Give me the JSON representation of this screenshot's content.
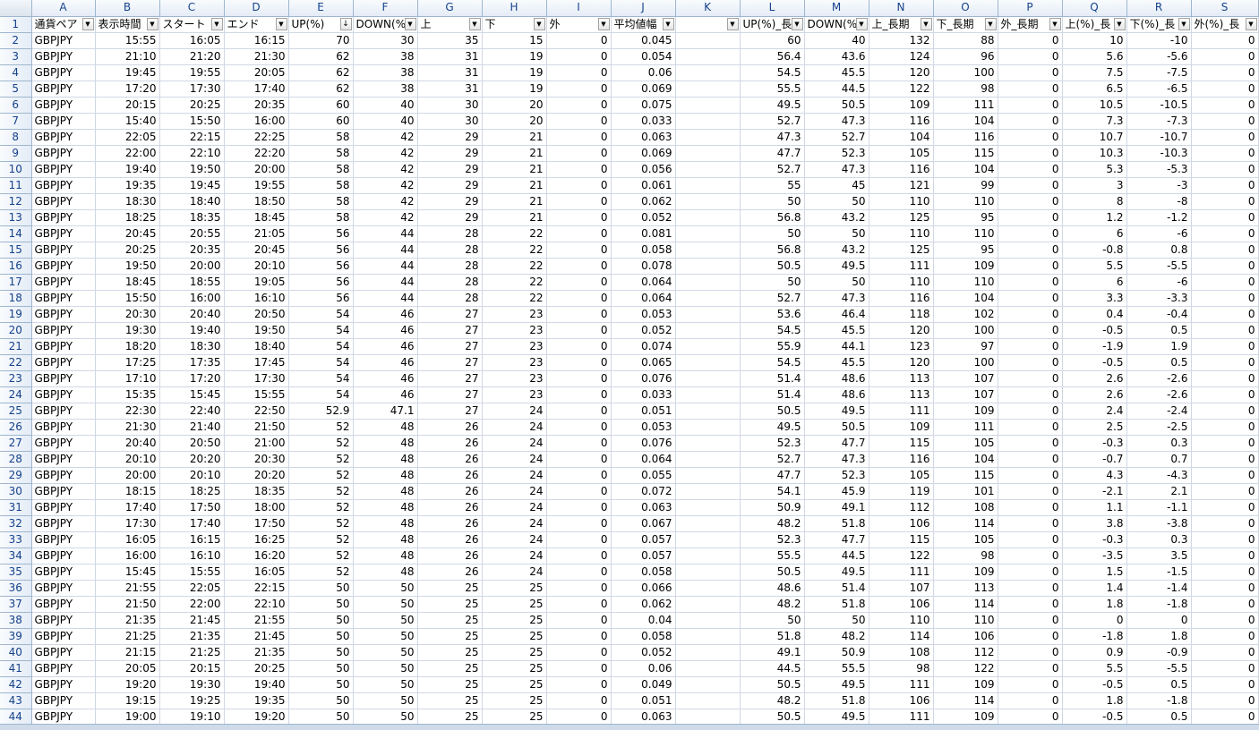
{
  "columns": [
    "A",
    "B",
    "C",
    "D",
    "E",
    "F",
    "G",
    "H",
    "I",
    "J",
    "K",
    "L",
    "M",
    "N",
    "O",
    "P",
    "Q",
    "R",
    "S"
  ],
  "header_row_number": "1",
  "headers": [
    "通貨ペア",
    "表示時間",
    "スタート",
    "エンド",
    "UP(%)",
    "DOWN(%)",
    "上",
    "下",
    "外",
    "平均値幅",
    "",
    "UP(%)_長",
    "DOWN(%)",
    "上_長期",
    "下_長期",
    "外_長期",
    "上(%)_長",
    "下(%)_長",
    "外(%)_長"
  ],
  "sorted_column_index": 4,
  "filter_icon": "▼",
  "sorted_icon": "↓",
  "rows": [
    [
      "2",
      "GBPJPY",
      "15:55",
      "16:05",
      "16:15",
      "70",
      "30",
      "35",
      "15",
      "0",
      "0.045",
      "",
      "60",
      "40",
      "132",
      "88",
      "0",
      "10",
      "-10",
      "0"
    ],
    [
      "3",
      "GBPJPY",
      "21:10",
      "21:20",
      "21:30",
      "62",
      "38",
      "31",
      "19",
      "0",
      "0.054",
      "",
      "56.4",
      "43.6",
      "124",
      "96",
      "0",
      "5.6",
      "-5.6",
      "0"
    ],
    [
      "4",
      "GBPJPY",
      "19:45",
      "19:55",
      "20:05",
      "62",
      "38",
      "31",
      "19",
      "0",
      "0.06",
      "",
      "54.5",
      "45.5",
      "120",
      "100",
      "0",
      "7.5",
      "-7.5",
      "0"
    ],
    [
      "5",
      "GBPJPY",
      "17:20",
      "17:30",
      "17:40",
      "62",
      "38",
      "31",
      "19",
      "0",
      "0.069",
      "",
      "55.5",
      "44.5",
      "122",
      "98",
      "0",
      "6.5",
      "-6.5",
      "0"
    ],
    [
      "6",
      "GBPJPY",
      "20:15",
      "20:25",
      "20:35",
      "60",
      "40",
      "30",
      "20",
      "0",
      "0.075",
      "",
      "49.5",
      "50.5",
      "109",
      "111",
      "0",
      "10.5",
      "-10.5",
      "0"
    ],
    [
      "7",
      "GBPJPY",
      "15:40",
      "15:50",
      "16:00",
      "60",
      "40",
      "30",
      "20",
      "0",
      "0.033",
      "",
      "52.7",
      "47.3",
      "116",
      "104",
      "0",
      "7.3",
      "-7.3",
      "0"
    ],
    [
      "8",
      "GBPJPY",
      "22:05",
      "22:15",
      "22:25",
      "58",
      "42",
      "29",
      "21",
      "0",
      "0.063",
      "",
      "47.3",
      "52.7",
      "104",
      "116",
      "0",
      "10.7",
      "-10.7",
      "0"
    ],
    [
      "9",
      "GBPJPY",
      "22:00",
      "22:10",
      "22:20",
      "58",
      "42",
      "29",
      "21",
      "0",
      "0.069",
      "",
      "47.7",
      "52.3",
      "105",
      "115",
      "0",
      "10.3",
      "-10.3",
      "0"
    ],
    [
      "10",
      "GBPJPY",
      "19:40",
      "19:50",
      "20:00",
      "58",
      "42",
      "29",
      "21",
      "0",
      "0.056",
      "",
      "52.7",
      "47.3",
      "116",
      "104",
      "0",
      "5.3",
      "-5.3",
      "0"
    ],
    [
      "11",
      "GBPJPY",
      "19:35",
      "19:45",
      "19:55",
      "58",
      "42",
      "29",
      "21",
      "0",
      "0.061",
      "",
      "55",
      "45",
      "121",
      "99",
      "0",
      "3",
      "-3",
      "0"
    ],
    [
      "12",
      "GBPJPY",
      "18:30",
      "18:40",
      "18:50",
      "58",
      "42",
      "29",
      "21",
      "0",
      "0.062",
      "",
      "50",
      "50",
      "110",
      "110",
      "0",
      "8",
      "-8",
      "0"
    ],
    [
      "13",
      "GBPJPY",
      "18:25",
      "18:35",
      "18:45",
      "58",
      "42",
      "29",
      "21",
      "0",
      "0.052",
      "",
      "56.8",
      "43.2",
      "125",
      "95",
      "0",
      "1.2",
      "-1.2",
      "0"
    ],
    [
      "14",
      "GBPJPY",
      "20:45",
      "20:55",
      "21:05",
      "56",
      "44",
      "28",
      "22",
      "0",
      "0.081",
      "",
      "50",
      "50",
      "110",
      "110",
      "0",
      "6",
      "-6",
      "0"
    ],
    [
      "15",
      "GBPJPY",
      "20:25",
      "20:35",
      "20:45",
      "56",
      "44",
      "28",
      "22",
      "0",
      "0.058",
      "",
      "56.8",
      "43.2",
      "125",
      "95",
      "0",
      "-0.8",
      "0.8",
      "0"
    ],
    [
      "16",
      "GBPJPY",
      "19:50",
      "20:00",
      "20:10",
      "56",
      "44",
      "28",
      "22",
      "0",
      "0.078",
      "",
      "50.5",
      "49.5",
      "111",
      "109",
      "0",
      "5.5",
      "-5.5",
      "0"
    ],
    [
      "17",
      "GBPJPY",
      "18:45",
      "18:55",
      "19:05",
      "56",
      "44",
      "28",
      "22",
      "0",
      "0.064",
      "",
      "50",
      "50",
      "110",
      "110",
      "0",
      "6",
      "-6",
      "0"
    ],
    [
      "18",
      "GBPJPY",
      "15:50",
      "16:00",
      "16:10",
      "56",
      "44",
      "28",
      "22",
      "0",
      "0.064",
      "",
      "52.7",
      "47.3",
      "116",
      "104",
      "0",
      "3.3",
      "-3.3",
      "0"
    ],
    [
      "19",
      "GBPJPY",
      "20:30",
      "20:40",
      "20:50",
      "54",
      "46",
      "27",
      "23",
      "0",
      "0.053",
      "",
      "53.6",
      "46.4",
      "118",
      "102",
      "0",
      "0.4",
      "-0.4",
      "0"
    ],
    [
      "20",
      "GBPJPY",
      "19:30",
      "19:40",
      "19:50",
      "54",
      "46",
      "27",
      "23",
      "0",
      "0.052",
      "",
      "54.5",
      "45.5",
      "120",
      "100",
      "0",
      "-0.5",
      "0.5",
      "0"
    ],
    [
      "21",
      "GBPJPY",
      "18:20",
      "18:30",
      "18:40",
      "54",
      "46",
      "27",
      "23",
      "0",
      "0.074",
      "",
      "55.9",
      "44.1",
      "123",
      "97",
      "0",
      "-1.9",
      "1.9",
      "0"
    ],
    [
      "22",
      "GBPJPY",
      "17:25",
      "17:35",
      "17:45",
      "54",
      "46",
      "27",
      "23",
      "0",
      "0.065",
      "",
      "54.5",
      "45.5",
      "120",
      "100",
      "0",
      "-0.5",
      "0.5",
      "0"
    ],
    [
      "23",
      "GBPJPY",
      "17:10",
      "17:20",
      "17:30",
      "54",
      "46",
      "27",
      "23",
      "0",
      "0.076",
      "",
      "51.4",
      "48.6",
      "113",
      "107",
      "0",
      "2.6",
      "-2.6",
      "0"
    ],
    [
      "24",
      "GBPJPY",
      "15:35",
      "15:45",
      "15:55",
      "54",
      "46",
      "27",
      "23",
      "0",
      "0.033",
      "",
      "51.4",
      "48.6",
      "113",
      "107",
      "0",
      "2.6",
      "-2.6",
      "0"
    ],
    [
      "25",
      "GBPJPY",
      "22:30",
      "22:40",
      "22:50",
      "52.9",
      "47.1",
      "27",
      "24",
      "0",
      "0.051",
      "",
      "50.5",
      "49.5",
      "111",
      "109",
      "0",
      "2.4",
      "-2.4",
      "0"
    ],
    [
      "26",
      "GBPJPY",
      "21:30",
      "21:40",
      "21:50",
      "52",
      "48",
      "26",
      "24",
      "0",
      "0.053",
      "",
      "49.5",
      "50.5",
      "109",
      "111",
      "0",
      "2.5",
      "-2.5",
      "0"
    ],
    [
      "27",
      "GBPJPY",
      "20:40",
      "20:50",
      "21:00",
      "52",
      "48",
      "26",
      "24",
      "0",
      "0.076",
      "",
      "52.3",
      "47.7",
      "115",
      "105",
      "0",
      "-0.3",
      "0.3",
      "0"
    ],
    [
      "28",
      "GBPJPY",
      "20:10",
      "20:20",
      "20:30",
      "52",
      "48",
      "26",
      "24",
      "0",
      "0.064",
      "",
      "52.7",
      "47.3",
      "116",
      "104",
      "0",
      "-0.7",
      "0.7",
      "0"
    ],
    [
      "29",
      "GBPJPY",
      "20:00",
      "20:10",
      "20:20",
      "52",
      "48",
      "26",
      "24",
      "0",
      "0.055",
      "",
      "47.7",
      "52.3",
      "105",
      "115",
      "0",
      "4.3",
      "-4.3",
      "0"
    ],
    [
      "30",
      "GBPJPY",
      "18:15",
      "18:25",
      "18:35",
      "52",
      "48",
      "26",
      "24",
      "0",
      "0.072",
      "",
      "54.1",
      "45.9",
      "119",
      "101",
      "0",
      "-2.1",
      "2.1",
      "0"
    ],
    [
      "31",
      "GBPJPY",
      "17:40",
      "17:50",
      "18:00",
      "52",
      "48",
      "26",
      "24",
      "0",
      "0.063",
      "",
      "50.9",
      "49.1",
      "112",
      "108",
      "0",
      "1.1",
      "-1.1",
      "0"
    ],
    [
      "32",
      "GBPJPY",
      "17:30",
      "17:40",
      "17:50",
      "52",
      "48",
      "26",
      "24",
      "0",
      "0.067",
      "",
      "48.2",
      "51.8",
      "106",
      "114",
      "0",
      "3.8",
      "-3.8",
      "0"
    ],
    [
      "33",
      "GBPJPY",
      "16:05",
      "16:15",
      "16:25",
      "52",
      "48",
      "26",
      "24",
      "0",
      "0.057",
      "",
      "52.3",
      "47.7",
      "115",
      "105",
      "0",
      "-0.3",
      "0.3",
      "0"
    ],
    [
      "34",
      "GBPJPY",
      "16:00",
      "16:10",
      "16:20",
      "52",
      "48",
      "26",
      "24",
      "0",
      "0.057",
      "",
      "55.5",
      "44.5",
      "122",
      "98",
      "0",
      "-3.5",
      "3.5",
      "0"
    ],
    [
      "35",
      "GBPJPY",
      "15:45",
      "15:55",
      "16:05",
      "52",
      "48",
      "26",
      "24",
      "0",
      "0.058",
      "",
      "50.5",
      "49.5",
      "111",
      "109",
      "0",
      "1.5",
      "-1.5",
      "0"
    ],
    [
      "36",
      "GBPJPY",
      "21:55",
      "22:05",
      "22:15",
      "50",
      "50",
      "25",
      "25",
      "0",
      "0.066",
      "",
      "48.6",
      "51.4",
      "107",
      "113",
      "0",
      "1.4",
      "-1.4",
      "0"
    ],
    [
      "37",
      "GBPJPY",
      "21:50",
      "22:00",
      "22:10",
      "50",
      "50",
      "25",
      "25",
      "0",
      "0.062",
      "",
      "48.2",
      "51.8",
      "106",
      "114",
      "0",
      "1.8",
      "-1.8",
      "0"
    ],
    [
      "38",
      "GBPJPY",
      "21:35",
      "21:45",
      "21:55",
      "50",
      "50",
      "25",
      "25",
      "0",
      "0.04",
      "",
      "50",
      "50",
      "110",
      "110",
      "0",
      "0",
      "0",
      "0"
    ],
    [
      "39",
      "GBPJPY",
      "21:25",
      "21:35",
      "21:45",
      "50",
      "50",
      "25",
      "25",
      "0",
      "0.058",
      "",
      "51.8",
      "48.2",
      "114",
      "106",
      "0",
      "-1.8",
      "1.8",
      "0"
    ],
    [
      "40",
      "GBPJPY",
      "21:15",
      "21:25",
      "21:35",
      "50",
      "50",
      "25",
      "25",
      "0",
      "0.052",
      "",
      "49.1",
      "50.9",
      "108",
      "112",
      "0",
      "0.9",
      "-0.9",
      "0"
    ],
    [
      "41",
      "GBPJPY",
      "20:05",
      "20:15",
      "20:25",
      "50",
      "50",
      "25",
      "25",
      "0",
      "0.06",
      "",
      "44.5",
      "55.5",
      "98",
      "122",
      "0",
      "5.5",
      "-5.5",
      "0"
    ],
    [
      "42",
      "GBPJPY",
      "19:20",
      "19:30",
      "19:40",
      "50",
      "50",
      "25",
      "25",
      "0",
      "0.049",
      "",
      "50.5",
      "49.5",
      "111",
      "109",
      "0",
      "-0.5",
      "0.5",
      "0"
    ],
    [
      "43",
      "GBPJPY",
      "19:15",
      "19:25",
      "19:35",
      "50",
      "50",
      "25",
      "25",
      "0",
      "0.051",
      "",
      "48.2",
      "51.8",
      "106",
      "114",
      "0",
      "1.8",
      "-1.8",
      "0"
    ],
    [
      "44",
      "GBPJPY",
      "19:00",
      "19:10",
      "19:20",
      "50",
      "50",
      "25",
      "25",
      "0",
      "0.063",
      "",
      "50.5",
      "49.5",
      "111",
      "109",
      "0",
      "-0.5",
      "0.5",
      "0"
    ]
  ]
}
